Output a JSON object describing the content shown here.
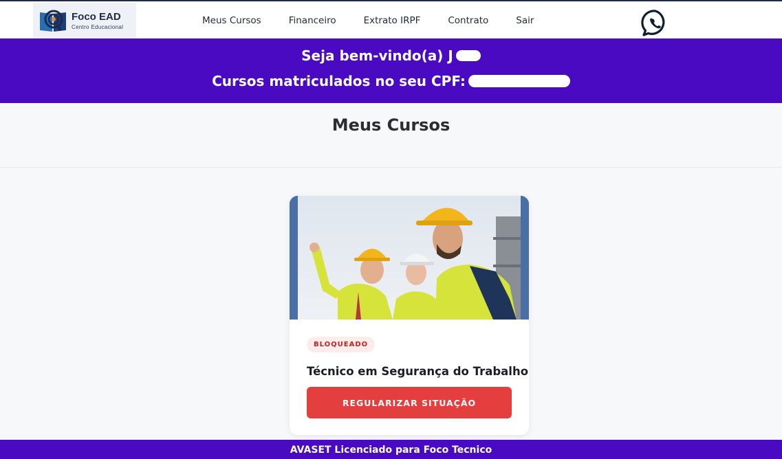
{
  "brand": {
    "name": "Foco EAD",
    "subtitle": "Centro Educacional"
  },
  "nav": {
    "items": [
      {
        "label": "Meus Cursos"
      },
      {
        "label": "Financeiro"
      },
      {
        "label": "Extrato IRPF"
      },
      {
        "label": "Contrato"
      },
      {
        "label": "Sair"
      }
    ],
    "whatsapp_icon": "whatsapp-icon"
  },
  "banner": {
    "welcome": "Seja bem-vindo(a) J",
    "cpf_label": "Cursos matriculados no seu CPF:"
  },
  "page": {
    "title": "Meus Cursos"
  },
  "courses": [
    {
      "status": "BLOQUEADO",
      "title": "Técnico em Segurança do Trabalho",
      "action": "REGULARIZAR SITUAÇÃO"
    }
  ],
  "footer": {
    "text": "AVASET Licenciado para Foco Tecnico"
  },
  "colors": {
    "primary": "#4a0ac2",
    "danger": "#e53e3e",
    "badge_bg": "#fdecec",
    "badge_text": "#c81e1e"
  }
}
